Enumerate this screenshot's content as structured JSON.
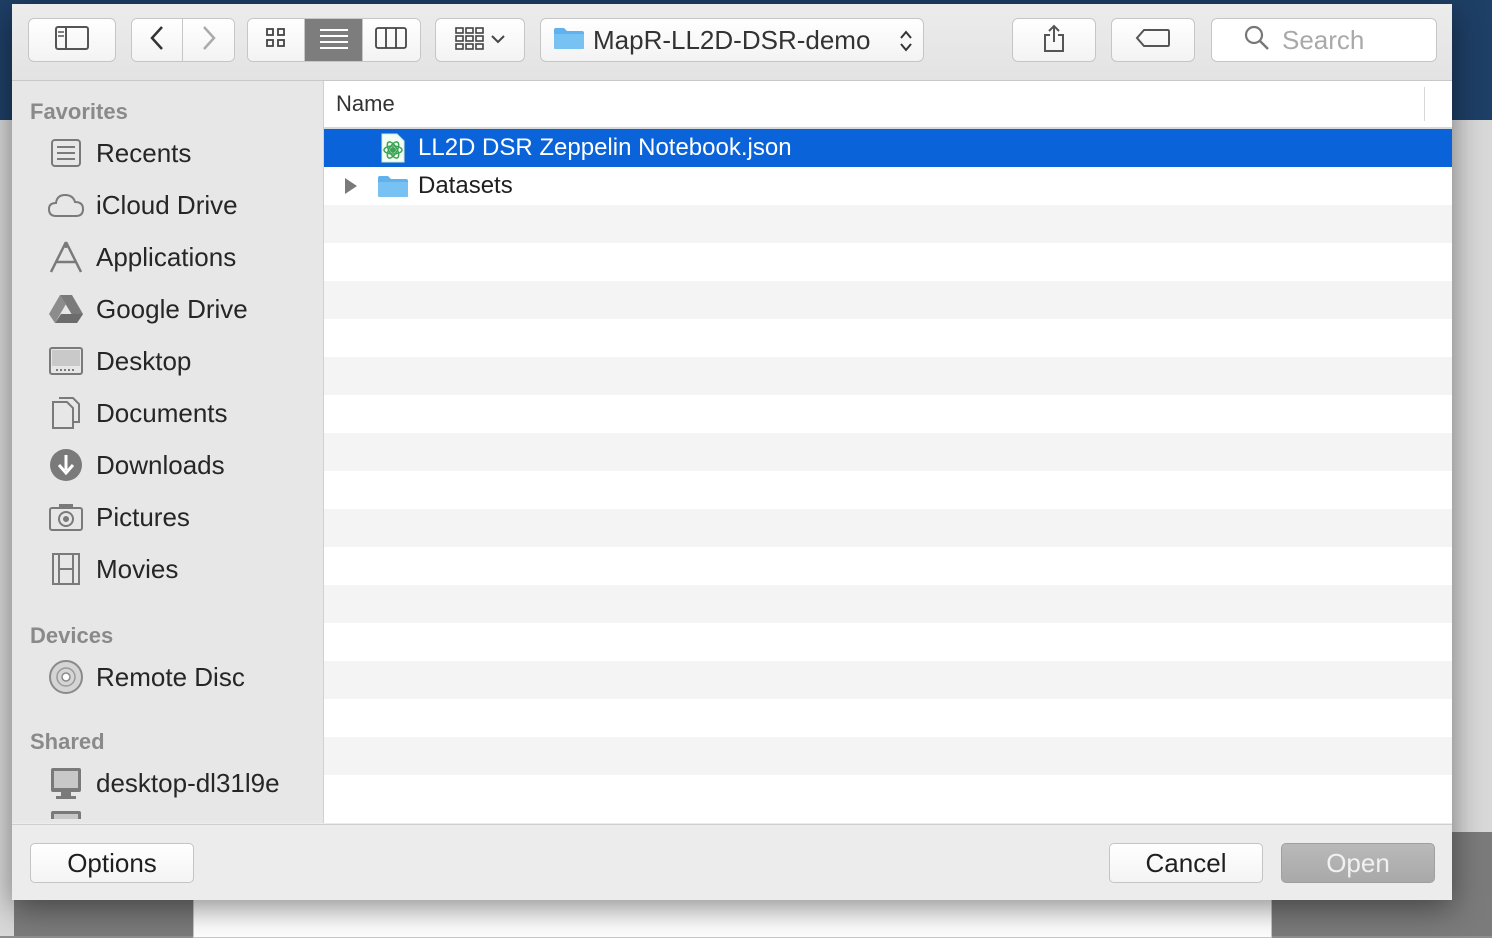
{
  "toolbar": {
    "path_label": "MapR-LL2D-DSR-demo",
    "search_placeholder": "Search"
  },
  "sidebar": {
    "favorites_header": "Favorites",
    "favorites": [
      {
        "label": "Recents",
        "icon": "recents-icon"
      },
      {
        "label": "iCloud Drive",
        "icon": "icloud-icon"
      },
      {
        "label": "Applications",
        "icon": "applications-icon"
      },
      {
        "label": "Google Drive",
        "icon": "google-drive-icon"
      },
      {
        "label": "Desktop",
        "icon": "desktop-icon"
      },
      {
        "label": "Documents",
        "icon": "documents-icon"
      },
      {
        "label": "Downloads",
        "icon": "downloads-icon"
      },
      {
        "label": "Pictures",
        "icon": "pictures-icon"
      },
      {
        "label": "Movies",
        "icon": "movies-icon"
      }
    ],
    "devices_header": "Devices",
    "devices": [
      {
        "label": "Remote Disc",
        "icon": "remote-disc-icon"
      }
    ],
    "shared_header": "Shared",
    "shared": [
      {
        "label": "desktop-dl31l9e",
        "icon": "computer-icon"
      }
    ]
  },
  "file_list": {
    "column_name": "Name",
    "items": [
      {
        "name": "LL2D DSR Zeppelin Notebook.json",
        "type": "file",
        "selected": true,
        "icon": "json-file-icon"
      },
      {
        "name": "Datasets",
        "type": "folder",
        "selected": false,
        "icon": "folder-icon"
      }
    ]
  },
  "buttons": {
    "options": "Options",
    "cancel": "Cancel",
    "open": "Open"
  },
  "colors": {
    "selection": "#0a63d8",
    "folder": "#5fb2ee"
  }
}
